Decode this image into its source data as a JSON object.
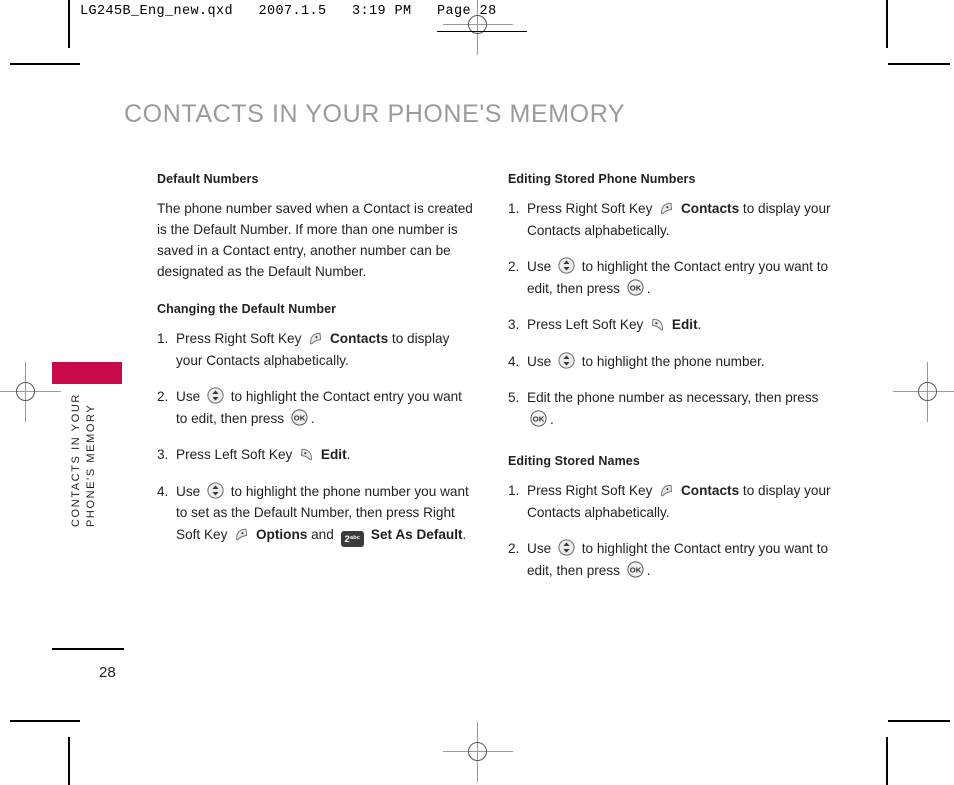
{
  "print_header": {
    "text": "LG245B_Eng_new.qxd   2007.1.5   3:19 PM   Page 28"
  },
  "page": {
    "title": "CONTACTS IN YOUR PHONE'S MEMORY",
    "number": "28",
    "side_tab_text": "CONTACTS IN YOUR\nPHONE'S MEMORY",
    "accent_color": "#c80a4b",
    "title_color": "#9a9a9f"
  },
  "icons": {
    "right_soft_key": "right-soft-key-icon",
    "left_soft_key": "left-soft-key-icon",
    "navigation": "navigation-up-down-icon",
    "ok_key": "ok-key-icon",
    "key_2": {
      "digit": "2",
      "letters": "abc"
    }
  },
  "left_column": {
    "section1": {
      "heading": "Default Numbers",
      "paragraph": "The phone number saved when a Contact is created is the Default Number. If more than one number is saved in a Contact entry, another number can be designated as the Default Number."
    },
    "section2": {
      "heading": "Changing the Default Number",
      "steps": [
        {
          "num": "1.",
          "parts": [
            {
              "t": "Press Right Soft Key "
            },
            {
              "icon": "right_soft_key"
            },
            {
              "t": " ",
              "bold": false
            },
            {
              "t": "Contacts",
              "bold": true
            },
            {
              "t": " to display your Contacts alphabetically."
            }
          ]
        },
        {
          "num": "2.",
          "parts": [
            {
              "t": "Use "
            },
            {
              "icon": "navigation"
            },
            {
              "t": " to highlight the Contact entry you want to edit, then press "
            },
            {
              "icon": "ok_key"
            },
            {
              "t": "."
            }
          ]
        },
        {
          "num": "3.",
          "parts": [
            {
              "t": "Press Left Soft Key "
            },
            {
              "icon": "left_soft_key"
            },
            {
              "t": " "
            },
            {
              "t": "Edit",
              "bold": true
            },
            {
              "t": "."
            }
          ]
        },
        {
          "num": "4.",
          "parts": [
            {
              "t": "Use "
            },
            {
              "icon": "navigation"
            },
            {
              "t": " to highlight the phone number you want to set as the Default Number, then press Right Soft Key "
            },
            {
              "icon": "right_soft_key"
            },
            {
              "t": " "
            },
            {
              "t": "Options",
              "bold": true
            },
            {
              "t": " and "
            },
            {
              "icon": "key_2"
            },
            {
              "t": " "
            },
            {
              "t": "Set As Default",
              "bold": true
            },
            {
              "t": "."
            }
          ]
        }
      ]
    }
  },
  "right_column": {
    "section1": {
      "heading": "Editing Stored Phone Numbers",
      "steps": [
        {
          "num": "1.",
          "parts": [
            {
              "t": "Press Right Soft Key "
            },
            {
              "icon": "right_soft_key"
            },
            {
              "t": " "
            },
            {
              "t": "Contacts",
              "bold": true
            },
            {
              "t": " to display your Contacts alphabetically."
            }
          ]
        },
        {
          "num": "2.",
          "parts": [
            {
              "t": "Use "
            },
            {
              "icon": "navigation"
            },
            {
              "t": " to highlight the Contact entry you want to edit, then press "
            },
            {
              "icon": "ok_key"
            },
            {
              "t": "."
            }
          ]
        },
        {
          "num": "3.",
          "parts": [
            {
              "t": "Press Left Soft Key "
            },
            {
              "icon": "left_soft_key"
            },
            {
              "t": " "
            },
            {
              "t": "Edit",
              "bold": true
            },
            {
              "t": "."
            }
          ]
        },
        {
          "num": "4.",
          "parts": [
            {
              "t": "Use "
            },
            {
              "icon": "navigation"
            },
            {
              "t": " to highlight the phone number."
            }
          ]
        },
        {
          "num": "5.",
          "parts": [
            {
              "t": "Edit the phone number as necessary, then press "
            },
            {
              "icon": "ok_key"
            },
            {
              "t": "."
            }
          ]
        }
      ]
    },
    "section2": {
      "heading": "Editing Stored Names",
      "steps": [
        {
          "num": "1.",
          "parts": [
            {
              "t": "Press Right Soft Key "
            },
            {
              "icon": "right_soft_key"
            },
            {
              "t": " "
            },
            {
              "t": "Contacts",
              "bold": true
            },
            {
              "t": " to display your Contacts alphabetically."
            }
          ]
        },
        {
          "num": "2.",
          "parts": [
            {
              "t": "Use "
            },
            {
              "icon": "navigation"
            },
            {
              "t": " to highlight the Contact entry you want to edit, then press "
            },
            {
              "icon": "ok_key"
            },
            {
              "t": "."
            }
          ]
        }
      ]
    }
  }
}
